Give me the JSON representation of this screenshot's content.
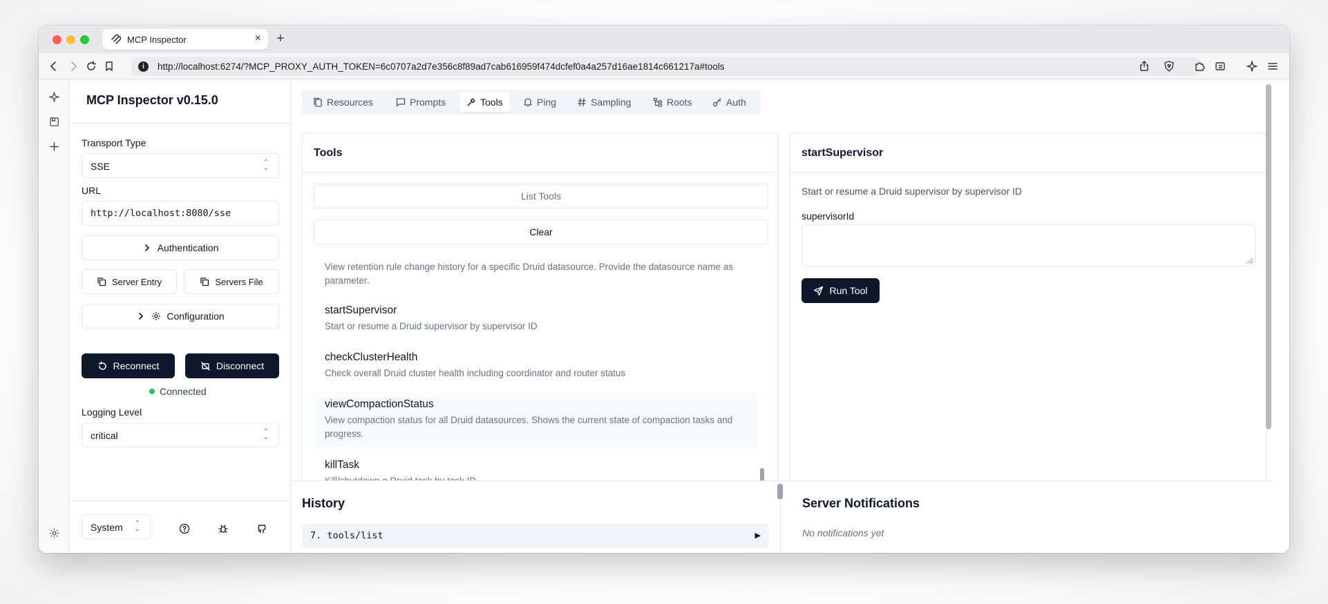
{
  "browser": {
    "tab_title": "MCP Inspector",
    "url": "http://localhost:6274/?MCP_PROXY_AUTH_TOKEN=6c0707a2d7e356c8f89ad7cab616959f474dcfef0a4a257d16ae1814c661217a#tools"
  },
  "sidebar": {
    "title": "MCP Inspector v0.15.0",
    "transport_label": "Transport Type",
    "transport_value": "SSE",
    "url_label": "URL",
    "url_value": "http://localhost:8080/sse",
    "authentication_label": "Authentication",
    "server_entry_label": "Server Entry",
    "servers_file_label": "Servers File",
    "configuration_label": "Configuration",
    "reconnect_label": "Reconnect",
    "disconnect_label": "Disconnect",
    "status_text": "Connected",
    "status_color": "#22c55e",
    "logging_label": "Logging Level",
    "logging_value": "critical",
    "theme_value": "System"
  },
  "tabs": [
    {
      "label": "Resources",
      "icon": "files-icon"
    },
    {
      "label": "Prompts",
      "icon": "message-square-icon"
    },
    {
      "label": "Tools",
      "icon": "hammer-icon",
      "active": true
    },
    {
      "label": "Ping",
      "icon": "bell-icon"
    },
    {
      "label": "Sampling",
      "icon": "hash-icon"
    },
    {
      "label": "Roots",
      "icon": "folder-tree-icon"
    },
    {
      "label": "Auth",
      "icon": "key-icon"
    }
  ],
  "tools_panel": {
    "title": "Tools",
    "list_tools_label": "List Tools",
    "clear_label": "Clear",
    "items": [
      {
        "name": "",
        "description": "View retention rule change history for a specific Druid datasource. Provide the datasource name as parameter."
      },
      {
        "name": "startSupervisor",
        "description": "Start or resume a Druid supervisor by supervisor ID"
      },
      {
        "name": "checkClusterHealth",
        "description": "Check overall Druid cluster health including coordinator and router status"
      },
      {
        "name": "viewCompactionStatus",
        "description": "View compaction status for all Druid datasources. Shows the current state of compaction tasks and progress."
      },
      {
        "name": "killTask",
        "description": "Kill/shutdown a Druid task by task ID"
      }
    ]
  },
  "tool_detail": {
    "title": "startSupervisor",
    "description": "Start or resume a Druid supervisor by supervisor ID",
    "param_label": "supervisorId",
    "param_value": "",
    "run_label": "Run Tool"
  },
  "history": {
    "title": "History",
    "entry": "7. tools/list",
    "expand_glyph": "▶"
  },
  "notifications": {
    "title": "Server Notifications",
    "empty_text": "No notifications yet"
  },
  "colors": {
    "primary": "#0f172a",
    "muted": "#64748b",
    "border": "#e5e7eb"
  }
}
